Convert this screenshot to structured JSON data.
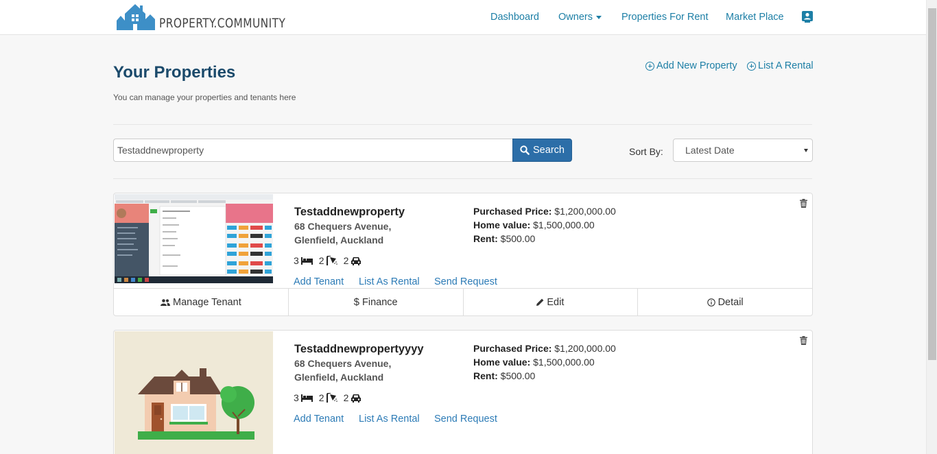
{
  "brand": {
    "name": "PROPERTY.COMMUNITY",
    "color": "#3d8fc7"
  },
  "nav": {
    "dashboard": "Dashboard",
    "owners": "Owners",
    "properties_for_rent": "Properties For Rent",
    "market_place": "Market Place"
  },
  "header": {
    "title": "Your Properties",
    "subtitle": "You can manage your properties and tenants here",
    "add_property": "Add New Property",
    "list_rental": "List A Rental"
  },
  "search": {
    "value": "Testaddnewproperty",
    "button_label": "Search",
    "sort_label": "Sort By:",
    "sort_value": "Latest Date"
  },
  "properties": [
    {
      "name": "Testaddnewproperty",
      "address_line1": "68 Chequers Avenue,",
      "address_line2": "Glenfield, Auckland",
      "bedrooms": "3",
      "bathrooms": "2",
      "parking": "2",
      "purchased_price_label": "Purchased Price:",
      "purchased_price": "$1,200,000.00",
      "home_value_label": "Home value:",
      "home_value": "$1,500,000.00",
      "rent_label": "Rent:",
      "rent": "$500.00",
      "image": "screenshot-thumbnail"
    },
    {
      "name": "Testaddnewpropertyyyy",
      "address_line1": "68 Chequers Avenue,",
      "address_line2": "Glenfield, Auckland",
      "bedrooms": "3",
      "bathrooms": "2",
      "parking": "2",
      "purchased_price_label": "Purchased Price:",
      "purchased_price": "$1,200,000.00",
      "home_value_label": "Home value:",
      "home_value": "$1,500,000.00",
      "rent_label": "Rent:",
      "rent": "$500.00",
      "image": "house-illustration"
    }
  ],
  "card_links": {
    "add_tenant": "Add Tenant",
    "list_as_rental": "List As Rental",
    "send_request": "Send Request"
  },
  "card_actions": {
    "manage_tenant": "Manage Tenant",
    "finance": "Finance",
    "edit": "Edit",
    "detail": "Detail"
  },
  "colors": {
    "link": "#1d7fa6",
    "title": "#1b4a6b",
    "search_button": "#2c6ea8"
  }
}
